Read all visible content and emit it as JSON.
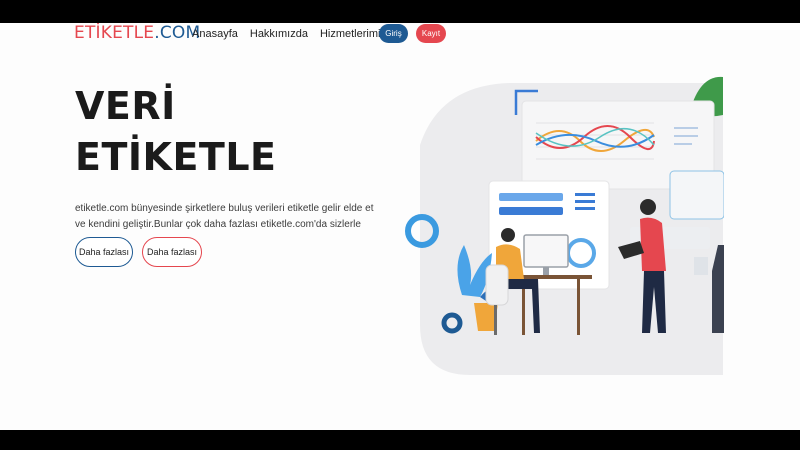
{
  "brand": {
    "part1": "ETİKETLE",
    "part2": ".COM",
    "color_red": "#e5474f",
    "color_blue": "#1e5a93"
  },
  "nav": {
    "items": [
      "Anasayfa",
      "Hakkımızda",
      "Hizmetlerimiz"
    ]
  },
  "auth": {
    "login": "Giriş",
    "register": "Kayıt"
  },
  "hero": {
    "title_line1": "VERİ",
    "title_line2": "ETİKETLE",
    "description": "etiketle.com bünyesinde şirketlere buluş verileri etiketle gelir elde et ve kendini geliştir.Bunlar çok daha fazlası etiketle.com'da sizlerle",
    "button1": "Daha fazlası",
    "button2": "Daha fazlası"
  }
}
